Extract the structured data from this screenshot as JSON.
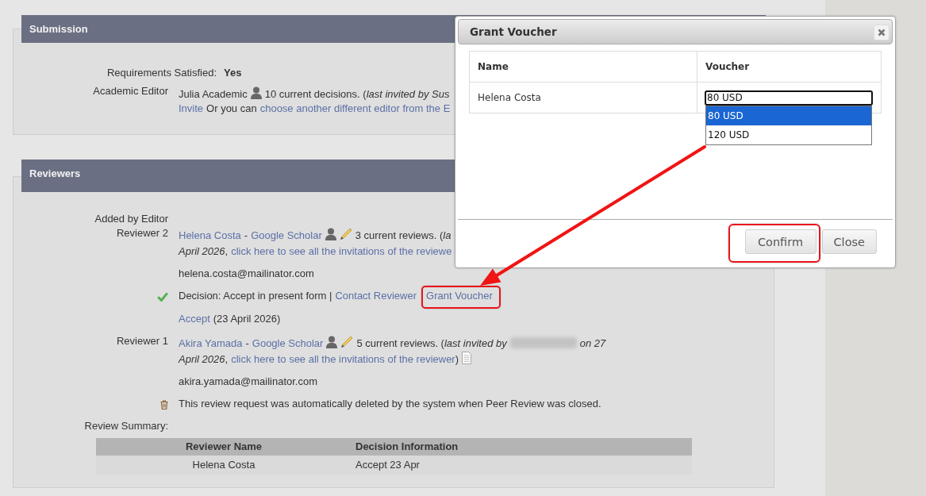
{
  "submission": {
    "title": "Submission",
    "requirements": {
      "label": "Requirements Satisfied:",
      "value": "Yes"
    },
    "rows": [
      {
        "kind": "field",
        "label": "Academic Editor",
        "lines": [
          [
            {
              "kind": "text",
              "text": "Julia Academic"
            },
            {
              "kind": "profile"
            },
            {
              "kind": "text",
              "text": "10 current decisions. (*last invited by Sus*"
            }
          ],
          [
            {
              "kind": "link",
              "text": "Invite"
            },
            {
              "kind": "text",
              "text": "Or you can"
            },
            {
              "kind": "link",
              "text": "choose another different editor from the E"
            }
          ]
        ]
      }
    ]
  },
  "reviewers": {
    "title": "Reviewers",
    "rows": [
      {
        "kind": "group",
        "label": "Added by Editor"
      },
      {
        "kind": "field",
        "label": "Reviewer 2",
        "lines": [
          [
            {
              "kind": "link",
              "text": "Helena Costa"
            },
            {
              "kind": "text",
              "text": "-"
            },
            {
              "kind": "link",
              "text": "Google Scholar"
            },
            {
              "kind": "profile"
            },
            {
              "kind": "edit"
            },
            {
              "kind": "text",
              "text": "3 current reviews. (*la*"
            }
          ],
          [
            {
              "kind": "note",
              "text": "April 2026"
            },
            {
              "kind": "punct",
              "text": ","
            },
            {
              "kind": "link",
              "text": "click here to see all the invitations of the reviewe"
            }
          ]
        ]
      },
      {
        "kind": "field",
        "lines": [
          [
            {
              "kind": "text",
              "text": "helena.costa@mailinator.com"
            }
          ]
        ]
      },
      {
        "kind": "decision",
        "lines": [
          [
            {
              "kind": "text",
              "text": "Decision: Accept in present form |"
            },
            {
              "kind": "link",
              "text": "Contact Reviewer"
            },
            {
              "kind": "highlighted_link",
              "text": "Grant Voucher"
            }
          ]
        ]
      },
      {
        "kind": "field",
        "lines": [
          [
            {
              "kind": "link",
              "text": "Accept"
            },
            {
              "kind": "text",
              "text": "(23 April 2026)"
            }
          ]
        ]
      },
      {
        "kind": "field",
        "label": "Reviewer 1",
        "lines": [
          [
            {
              "kind": "link",
              "text": "Akira Yamada"
            },
            {
              "kind": "text",
              "text": "-"
            },
            {
              "kind": "link",
              "text": "Google Scholar"
            },
            {
              "kind": "profile"
            },
            {
              "kind": "edit"
            },
            {
              "kind": "text",
              "text": "5 current reviews. (*last invited by*"
            },
            {
              "kind": "redacted"
            },
            {
              "kind": "note",
              "text": "on 27"
            }
          ],
          [
            {
              "kind": "note",
              "text": "April 2026"
            },
            {
              "kind": "punct",
              "text": ","
            },
            {
              "kind": "link",
              "text": "click here to see all the invitations of the reviewer"
            },
            {
              "kind": "punct",
              "text": ")"
            },
            {
              "kind": "document"
            }
          ]
        ]
      },
      {
        "kind": "field",
        "lines": [
          [
            {
              "kind": "text",
              "text": "akira.yamada@mailinator.com"
            }
          ]
        ]
      },
      {
        "kind": "deleted",
        "lines": [
          [
            {
              "kind": "text",
              "text": "This review request was automatically deleted by the system when Peer Review was closed."
            }
          ]
        ]
      }
    ],
    "summary": {
      "label": "Review Summary:",
      "columns": [
        "Reviewer Name",
        "Decision Information"
      ],
      "rows": [
        [
          "Helena Costa",
          "Accept 23 Apr"
        ]
      ]
    }
  },
  "dialog": {
    "title": "Grant Voucher",
    "columns": [
      "Name",
      "Voucher"
    ],
    "rows": [
      {
        "name": "Helena Costa",
        "voucher": {
          "value": "80 USD",
          "expanded": true,
          "options": [
            {
              "label": "80 USD",
              "selected": true
            },
            {
              "label": "120 USD",
              "selected": false
            }
          ]
        }
      }
    ],
    "buttons": [
      {
        "label": "Confirm",
        "highlighted": true
      },
      {
        "label": "Close",
        "highlighted": false
      }
    ]
  },
  "annotation_arrow": true
}
